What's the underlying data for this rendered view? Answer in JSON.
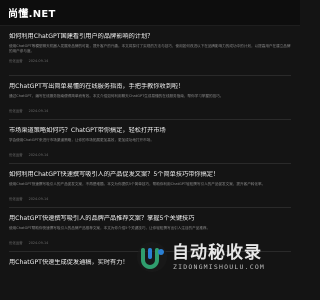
{
  "site": {
    "logo": "尚懂.NET"
  },
  "articles": [
    {
      "title": "如何利用ChatGPT国建看引用户的品牌影响的计划？",
      "excerpt": "使用ChatGPT等模型聊天机器人发展来品牌的可能，提升客户的兴趣。本文将探讨了实现的方法与技巧，使用如何改进以下在品牌影响力的成功中的计划，以提高用户在建立品牌的用户参与度。",
      "category": "优化运营",
      "date": "2024-09-14"
    },
    {
      "title": "用ChatGPT写出简单易懂的在线服务指南，手把手教你收到啦！",
      "excerpt": "通过ChatGPT，编写在线服务指南便得简单而有效。本文介绍如何利用聊天ChatGPT生成易懂的在线服务指南，帮你学习掌握的技巧。",
      "category": "优化运营",
      "date": "2024-09-14"
    },
    {
      "title": "市场渠道策略如何巧？ChatGPT带你搞定，轻松打开市场",
      "excerpt": "学会使用ChatGPT来进行市场渠道策略，让你的市场拓展更加高效，更加成功地打开市场。",
      "category": "优化运营",
      "date": "2024-09-14"
    },
    {
      "title": "如何利用ChatGPT快速撰写吸引人的产品促发文案？5个简单技巧带你搞定！",
      "excerpt": "使用ChatGPT快速撰写吸引人的产品促发文案，不再是难题。本文为你提供5个简单技巧，帮助你利用ChatGPT轻松撰写引人的产品促发文案，提升客户转化率。",
      "category": "优化运营",
      "date": "2024-09-14"
    },
    {
      "title": "用ChatGPT快速撰写吸引人的品牌产品推荐文案？掌握5个关键技巧",
      "excerpt": "使用ChatGPT帮助你快速撰写吸引人的品牌产品推荐文案，本文为你介绍5个关键技巧，让你轻松撰写出引人注目的产品推荐。",
      "category": "优化运营",
      "date": "2024-09-14"
    },
    {
      "title": "用ChatGPT快速生成促发通稿，实时有力！",
      "excerpt": "",
      "category": "",
      "date": ""
    }
  ],
  "watermark": {
    "brand": "自动秘收录",
    "url": "ZIDONGMISHOULU.COM"
  },
  "colors": {
    "background": "#141414",
    "header": "#0d0d0d",
    "accent_green": "#2f9e6e",
    "accent_blue": "#2a7fd4"
  }
}
